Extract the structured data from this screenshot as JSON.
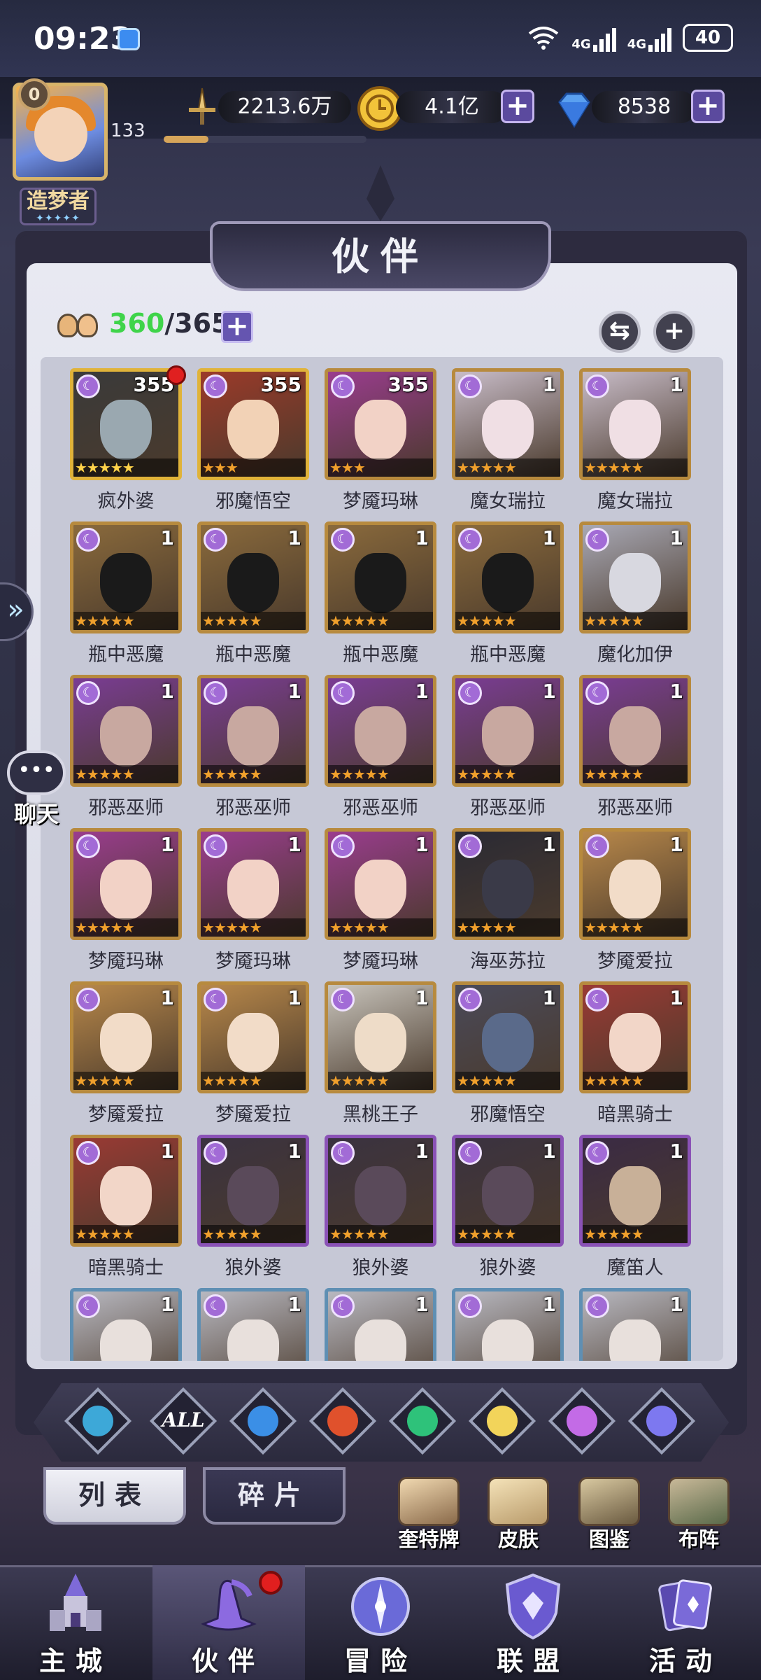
{
  "status_bar": {
    "time": "09:23",
    "network_1": "4G",
    "network_2": "4G",
    "battery": "40"
  },
  "player": {
    "avatar_badge": "0",
    "level": "133",
    "title": "造梦者",
    "title_stars": "✦✦✦✦✦",
    "xp_fraction": 0.22
  },
  "currency": {
    "power": "2213.6万",
    "gold": "4.1亿",
    "diamonds": "8538",
    "plus": "+"
  },
  "panel": {
    "title": "伙伴",
    "capacity_current": "360",
    "capacity_sep": "/",
    "capacity_max": "365",
    "capacity_plus": "+",
    "swap_icon": "⇆",
    "add_icon": "+"
  },
  "elements": [
    {
      "name": "awaken-filter",
      "label": "",
      "color": "#3da8d8"
    },
    {
      "name": "all-filter",
      "label": "ALL",
      "color": "#3a3a55"
    },
    {
      "name": "water-filter",
      "label": "",
      "color": "#3b8fe6"
    },
    {
      "name": "fire-filter",
      "label": "",
      "color": "#e0512c"
    },
    {
      "name": "wind-filter",
      "label": "",
      "color": "#2ec27a"
    },
    {
      "name": "light-filter",
      "label": "",
      "color": "#f2d45a"
    },
    {
      "name": "dark-filter",
      "label": "",
      "color": "#c36be6"
    },
    {
      "name": "cosmic-filter",
      "label": "",
      "color": "#7d78f0"
    }
  ],
  "tabs": {
    "list": "列表",
    "fragments": "碎片"
  },
  "shortcuts": [
    {
      "name": "cards",
      "label": "奎特牌"
    },
    {
      "name": "skins",
      "label": "皮肤"
    },
    {
      "name": "codex",
      "label": "图鉴"
    },
    {
      "name": "formation",
      "label": "布阵"
    }
  ],
  "nav": [
    {
      "name": "main-city",
      "label": "主城"
    },
    {
      "name": "partners",
      "label": "伙伴"
    },
    {
      "name": "adventure",
      "label": "冒险"
    },
    {
      "name": "alliance",
      "label": "联盟"
    },
    {
      "name": "activity",
      "label": "活动"
    }
  ],
  "side": {
    "expand_icon": "»",
    "chat_label": "聊天",
    "chat_icon": "•••"
  },
  "partners": [
    {
      "name": "疯外婆",
      "level": "355",
      "stars": "★★★★★",
      "rarity": "gold",
      "hair": "#3a3a3a",
      "skin": "#9aa8b0",
      "new": true
    },
    {
      "name": "邪魔悟空",
      "level": "355",
      "stars": "★★★",
      "rarity": "gold",
      "hair": "#9b3a2a",
      "skin": "#f2d2b6"
    },
    {
      "name": "梦魇玛琳",
      "level": "355",
      "stars": "★★★",
      "rarity": "orange",
      "hair": "#9a3c8e",
      "skin": "#f2d2c6"
    },
    {
      "name": "魔女瑞拉",
      "level": "1",
      "stars": "★★★★★",
      "rarity": "orange",
      "hair": "#c8bcc8",
      "skin": "#f0dfe4"
    },
    {
      "name": "魔女瑞拉",
      "level": "1",
      "stars": "★★★★★",
      "rarity": "orange",
      "hair": "#c8bcc8",
      "skin": "#f0dfe4"
    },
    {
      "name": "瓶中恶魔",
      "level": "1",
      "stars": "★★★★★",
      "rarity": "orange",
      "hair": "#8a6a3c",
      "skin": "#1a1a1a"
    },
    {
      "name": "瓶中恶魔",
      "level": "1",
      "stars": "★★★★★",
      "rarity": "orange",
      "hair": "#8a6a3c",
      "skin": "#1a1a1a"
    },
    {
      "name": "瓶中恶魔",
      "level": "1",
      "stars": "★★★★★",
      "rarity": "orange",
      "hair": "#8a6a3c",
      "skin": "#1a1a1a"
    },
    {
      "name": "瓶中恶魔",
      "level": "1",
      "stars": "★★★★★",
      "rarity": "orange",
      "hair": "#8a6a3c",
      "skin": "#1a1a1a"
    },
    {
      "name": "魔化加伊",
      "level": "1",
      "stars": "★★★★★",
      "rarity": "orange",
      "hair": "#a8a8b4",
      "skin": "#d8d8e0"
    },
    {
      "name": "邪恶巫师",
      "level": "1",
      "stars": "★★★★★",
      "rarity": "orange",
      "hair": "#7a3c94",
      "skin": "#c8a8a0"
    },
    {
      "name": "邪恶巫师",
      "level": "1",
      "stars": "★★★★★",
      "rarity": "orange",
      "hair": "#7a3c94",
      "skin": "#c8a8a0"
    },
    {
      "name": "邪恶巫师",
      "level": "1",
      "stars": "★★★★★",
      "rarity": "orange",
      "hair": "#7a3c94",
      "skin": "#c8a8a0"
    },
    {
      "name": "邪恶巫师",
      "level": "1",
      "stars": "★★★★★",
      "rarity": "orange",
      "hair": "#7a3c94",
      "skin": "#c8a8a0"
    },
    {
      "name": "邪恶巫师",
      "level": "1",
      "stars": "★★★★★",
      "rarity": "orange",
      "hair": "#7a3c94",
      "skin": "#c8a8a0"
    },
    {
      "name": "梦魇玛琳",
      "level": "1",
      "stars": "★★★★★",
      "rarity": "orange",
      "hair": "#9a3c8e",
      "skin": "#f2d2c6"
    },
    {
      "name": "梦魇玛琳",
      "level": "1",
      "stars": "★★★★★",
      "rarity": "orange",
      "hair": "#9a3c8e",
      "skin": "#f2d2c6"
    },
    {
      "name": "梦魇玛琳",
      "level": "1",
      "stars": "★★★★★",
      "rarity": "orange",
      "hair": "#9a3c8e",
      "skin": "#f2d2c6"
    },
    {
      "name": "海巫苏拉",
      "level": "1",
      "stars": "★★★★★",
      "rarity": "orange",
      "hair": "#2a2a34",
      "skin": "#3a3a48"
    },
    {
      "name": "梦魇爱拉",
      "level": "1",
      "stars": "★★★★★",
      "rarity": "orange",
      "hair": "#b8884a",
      "skin": "#f2dcc8"
    },
    {
      "name": "梦魇爱拉",
      "level": "1",
      "stars": "★★★★★",
      "rarity": "orange",
      "hair": "#b8884a",
      "skin": "#f2dcc8"
    },
    {
      "name": "梦魇爱拉",
      "level": "1",
      "stars": "★★★★★",
      "rarity": "orange",
      "hair": "#b8884a",
      "skin": "#f2dcc8"
    },
    {
      "name": "黑桃王子",
      "level": "1",
      "stars": "★★★★★",
      "rarity": "orange",
      "hair": "#c8c4bc",
      "skin": "#eedcc8"
    },
    {
      "name": "邪魔悟空",
      "level": "1",
      "stars": "★★★★★",
      "rarity": "orange",
      "hair": "#4a4a5a",
      "skin": "#5a6a8a"
    },
    {
      "name": "暗黑骑士",
      "level": "1",
      "stars": "★★★★★",
      "rarity": "orange",
      "hair": "#9a3a34",
      "skin": "#f2d6c8"
    },
    {
      "name": "暗黑骑士",
      "level": "1",
      "stars": "★★★★★",
      "rarity": "orange",
      "hair": "#9a3a34",
      "skin": "#f2d6c8"
    },
    {
      "name": "狼外婆",
      "level": "1",
      "stars": "★★★★★",
      "rarity": "purple",
      "hair": "#3a3240",
      "skin": "#5a4a5a"
    },
    {
      "name": "狼外婆",
      "level": "1",
      "stars": "★★★★★",
      "rarity": "purple",
      "hair": "#3a3240",
      "skin": "#5a4a5a"
    },
    {
      "name": "狼外婆",
      "level": "1",
      "stars": "★★★★★",
      "rarity": "purple",
      "hair": "#3a3240",
      "skin": "#5a4a5a"
    },
    {
      "name": "魔笛人",
      "level": "1",
      "stars": "★★★★★",
      "rarity": "purple",
      "hair": "#3a2a44",
      "skin": "#c8b098"
    },
    {
      "name": "",
      "level": "1",
      "stars": "",
      "rarity": "blue",
      "hair": "#b8b8c0",
      "skin": "#e8e0dc"
    },
    {
      "name": "",
      "level": "1",
      "stars": "",
      "rarity": "blue",
      "hair": "#b8b8c0",
      "skin": "#e8e0dc"
    },
    {
      "name": "",
      "level": "1",
      "stars": "",
      "rarity": "blue",
      "hair": "#b8b8c0",
      "skin": "#e8e0dc"
    },
    {
      "name": "",
      "level": "1",
      "stars": "",
      "rarity": "blue",
      "hair": "#b8b8c0",
      "skin": "#e8e0dc"
    },
    {
      "name": "",
      "level": "1",
      "stars": "",
      "rarity": "blue",
      "hair": "#b8b8c0",
      "skin": "#e8e0dc"
    }
  ]
}
